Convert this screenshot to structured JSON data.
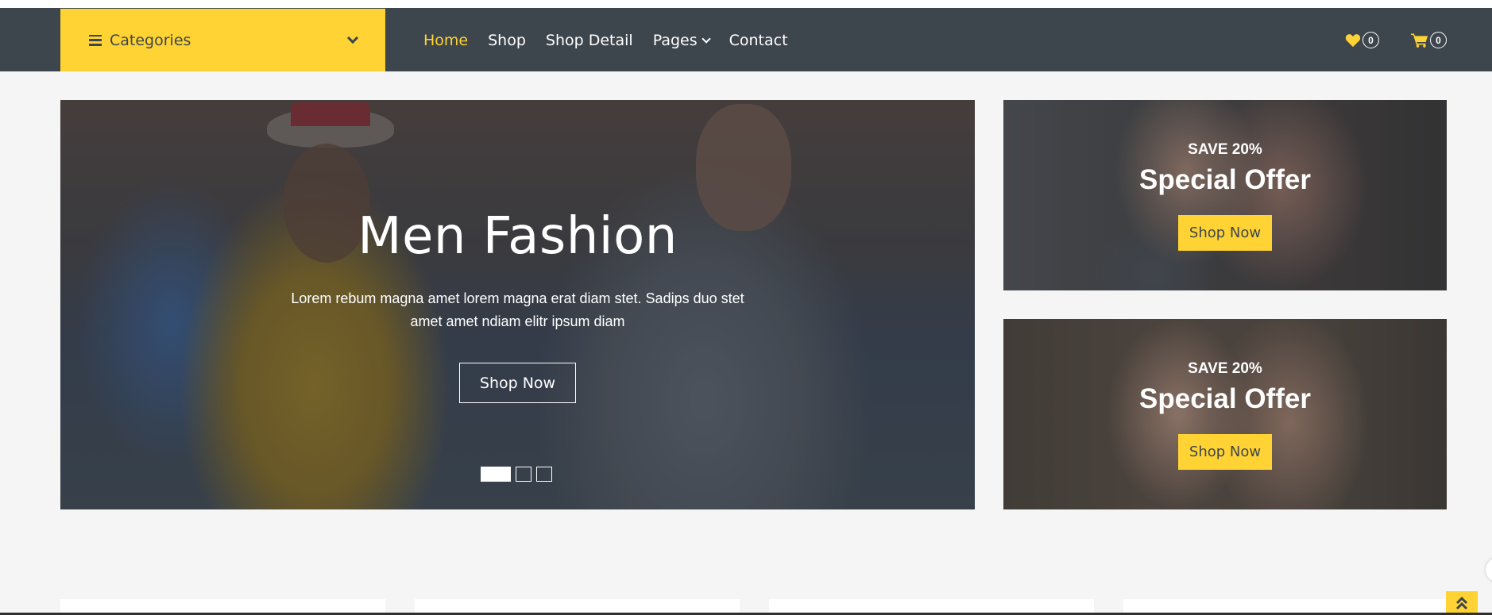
{
  "navbar": {
    "categories_label": "Categories",
    "menu": [
      {
        "label": "Home",
        "active": true
      },
      {
        "label": "Shop"
      },
      {
        "label": "Shop Detail"
      },
      {
        "label": "Pages"
      },
      {
        "label": "Contact"
      }
    ],
    "wishlist_count": "0",
    "cart_count": "0"
  },
  "hero": {
    "title": "Men Fashion",
    "text": "Lorem rebum magna amet lorem magna erat diam stet. Sadips duo stet amet amet ndiam elitr ipsum diam",
    "button": "Shop Now",
    "slides": 3,
    "active_slide": 1
  },
  "offers": [
    {
      "save": "SAVE 20%",
      "title": "Special Offer",
      "button": "Shop Now"
    },
    {
      "save": "SAVE 20%",
      "title": "Special Offer",
      "button": "Shop Now"
    }
  ],
  "colors": {
    "accent": "#ffd333",
    "dark": "#3d464d",
    "background": "#f5f5f5"
  },
  "icons": {
    "menu": "bars-icon",
    "wishlist": "heart-icon",
    "cart": "shopping-cart-icon",
    "back_to_top": "double-chevron-up-icon"
  }
}
